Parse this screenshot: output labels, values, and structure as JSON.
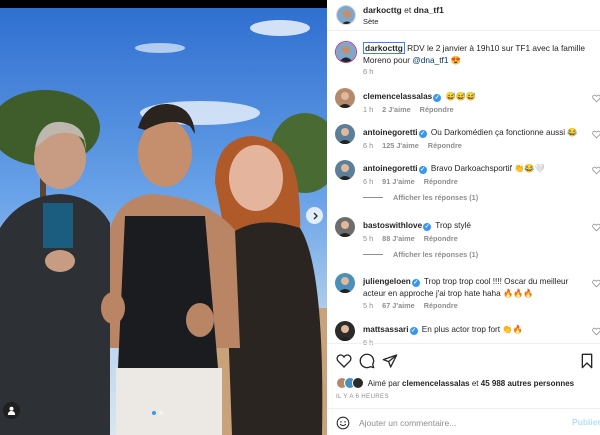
{
  "post": {
    "author": "darkocttg",
    "conjunction": "et",
    "coauthor": "dna_tf1",
    "location": "Sète",
    "caption": {
      "handle": "darkocttg",
      "text": " RDV le 2 janvier à 19h10 sur TF1 avec la famille Moreno pour ",
      "mention": "@dna_tf1",
      "emoji": " 😍",
      "time": "6 h"
    },
    "photo": {
      "tag_icon": "person-tag-icon",
      "next_icon": "chevron-right-icon",
      "carousel_count": 2,
      "carousel_active": 1
    }
  },
  "comments": [
    {
      "user": "clemencelassalas",
      "verified": true,
      "text": " 😅😅😅",
      "time": "1 h",
      "likes": "2 J'aime",
      "reply": "Répondre",
      "avatar_color": "#b48a6b"
    },
    {
      "user": "antoinegoretti",
      "verified": true,
      "text": " Ou Darkomédien ça fonctionne aussi 😂",
      "time": "6 h",
      "likes": "125 J'aime",
      "reply": "Répondre",
      "avatar_color": "#5b7f99"
    },
    {
      "user": "antoinegoretti",
      "verified": true,
      "text": " Bravo Darkoachsportif 👏😂🤍",
      "time": "6 h",
      "likes": "91 J'aime",
      "reply": "Répondre",
      "avatar_color": "#5b7f99",
      "replies": "Afficher les réponses (1)"
    },
    {
      "user": "bastoswithlove",
      "verified": true,
      "text": " Trop stylé",
      "time": "5 h",
      "likes": "88 J'aime",
      "reply": "Répondre",
      "avatar_color": "#6d6d6d",
      "replies": "Afficher les réponses (1)"
    },
    {
      "user": "juliengeloen",
      "verified": true,
      "text": " Trop trop trop cool !!!! Oscar du meilleur acteur en approche j'ai trop hate haha 🔥🔥🔥",
      "time": "5 h",
      "likes": "67 J'aime",
      "reply": "Répondre",
      "avatar_color": "#4a90b8"
    },
    {
      "user": "mattsassari",
      "verified": true,
      "text": " En plus actor trop fort 👏🔥",
      "time": "6 h",
      "likes": "",
      "reply": "",
      "avatar_color": "#2b2b2b"
    }
  ],
  "likes_summary": {
    "prefix": "Aimé par ",
    "first_user": "clemencelassalas",
    "middle": " et ",
    "count": "45 988 autres personnes"
  },
  "post_time": "IL Y A 6 HEURES",
  "comment_box": {
    "placeholder": "Ajouter un commentaire...",
    "publish_label": "Publier"
  },
  "icons": {
    "heart": "heart-icon",
    "comment": "comment-icon",
    "share": "share-icon",
    "save": "bookmark-icon",
    "emoji": "emoji-icon"
  },
  "colors": {
    "verified": "#3897f0",
    "mention": "#00376b",
    "muted": "#8e8e8e",
    "publish": "#b2dffc"
  }
}
